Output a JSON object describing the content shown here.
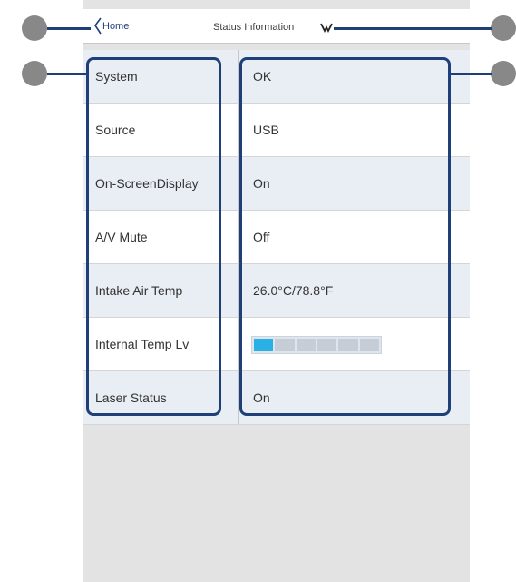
{
  "header": {
    "home_label": "Home",
    "title": "Status Information"
  },
  "rows": [
    {
      "label": "System",
      "value": "OK"
    },
    {
      "label": "Source",
      "value": "USB"
    },
    {
      "label": "On-ScreenDisplay",
      "value": "On"
    },
    {
      "label": "A/V Mute",
      "value": "Off"
    },
    {
      "label": "Intake Air Temp",
      "value": "26.0°C/78.8°F"
    },
    {
      "label": "Internal Temp Lv",
      "value": ""
    },
    {
      "label": "Laser Status",
      "value": "On"
    }
  ],
  "internal_temp_level": {
    "filled_segments": 1,
    "total_segments": 6
  },
  "colors": {
    "row_even": "#e9eef5",
    "row_odd": "#ffffff",
    "accent": "#1e3f78",
    "temp_active": "#29b0e5"
  },
  "callouts": {
    "count": 4
  }
}
